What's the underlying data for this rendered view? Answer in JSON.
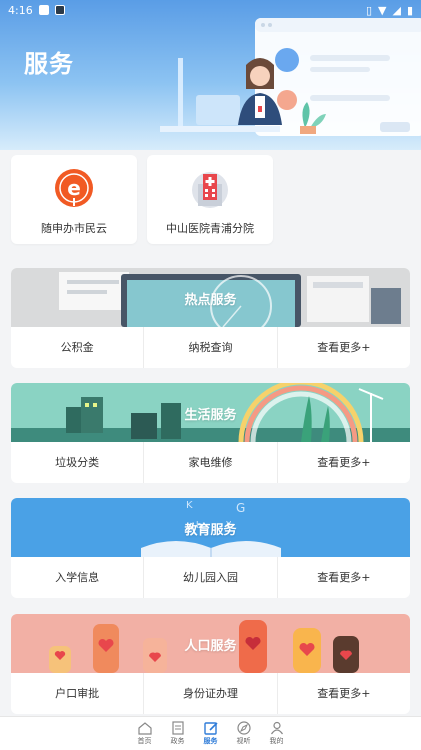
{
  "status_bar": {
    "time": "4:16"
  },
  "header": {
    "title": "服务"
  },
  "shortcuts": [
    {
      "label": "随申办市民云",
      "icon": "e-citizen-cloud-icon"
    },
    {
      "label": "中山医院青浦分院",
      "icon": "hospital-icon"
    }
  ],
  "sections": [
    {
      "title": "热点服务",
      "links": [
        "公积金",
        "纳税查询",
        "查看更多+"
      ]
    },
    {
      "title": "生活服务",
      "links": [
        "垃圾分类",
        "家电维修",
        "查看更多+"
      ]
    },
    {
      "title": "教育服务",
      "links": [
        "入学信息",
        "幼儿园入园",
        "查看更多+"
      ]
    },
    {
      "title": "人口服务",
      "links": [
        "户口审批",
        "身份证办理",
        "查看更多+"
      ]
    }
  ],
  "bottom_nav": {
    "items": [
      {
        "label": "首页",
        "icon": "home-icon"
      },
      {
        "label": "政务",
        "icon": "document-icon"
      },
      {
        "label": "服务",
        "icon": "edit-icon",
        "active": true
      },
      {
        "label": "视听",
        "icon": "compass-icon"
      },
      {
        "label": "我的",
        "icon": "user-icon"
      }
    ]
  },
  "colors": {
    "accent": "#2f7cd8",
    "banner": "#5a9de6",
    "citizen_orange": "#f15a24",
    "hospital_red": "#e8474c"
  }
}
